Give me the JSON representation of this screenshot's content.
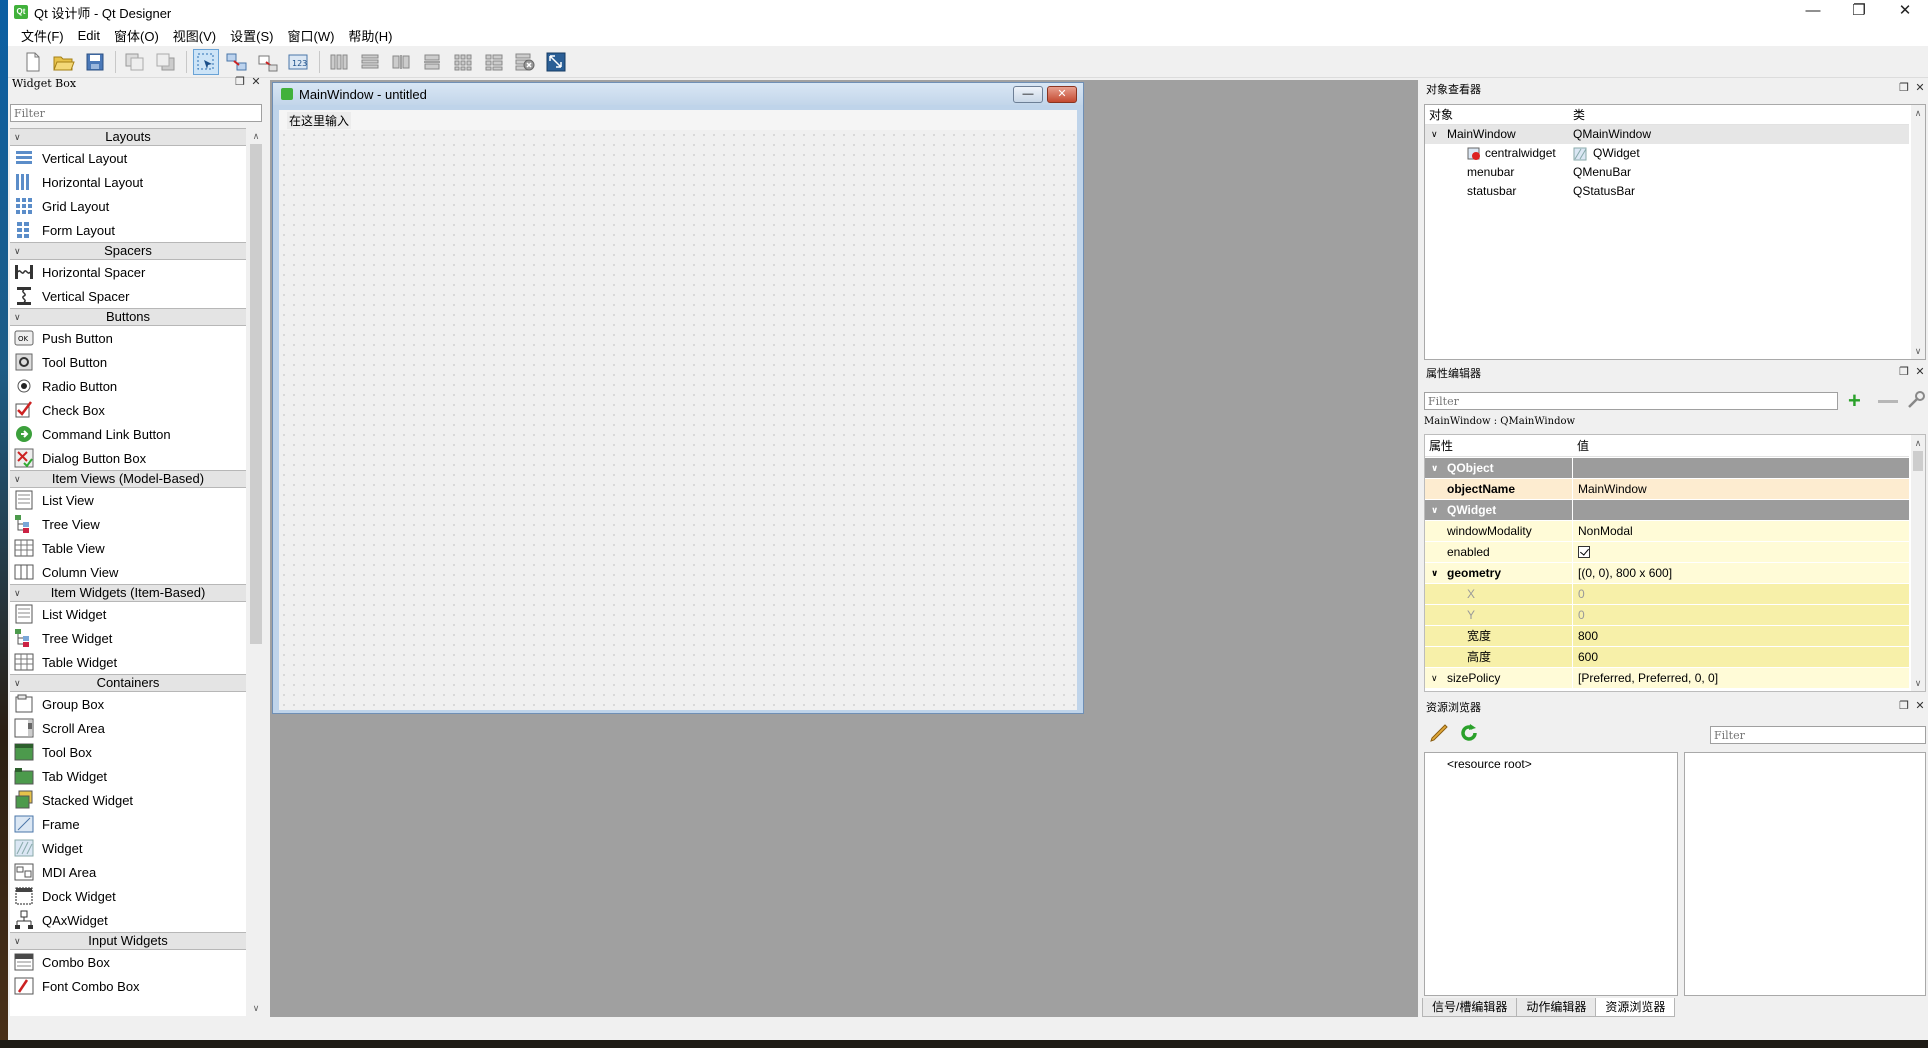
{
  "app": {
    "title": "Qt 设计师 - Qt Designer",
    "icon": "qt-icon"
  },
  "window_controls": {
    "minimize": "—",
    "restore": "❐",
    "close": "✕"
  },
  "menu": [
    "文件(F)",
    "Edit",
    "窗体(O)",
    "视图(V)",
    "设置(S)",
    "窗口(W)",
    "帮助(H)"
  ],
  "toolbar": {
    "icons": [
      "new-file-icon",
      "open-file-icon",
      "save-icon",
      "send-to-back-icon",
      "bring-to-front-icon",
      "edit-widgets-icon",
      "edit-signals-slots-icon",
      "edit-buddies-icon",
      "edit-tab-order-icon",
      "layout-horizontal-icon",
      "layout-vertical-icon",
      "layout-h-splitter-icon",
      "layout-v-splitter-icon",
      "layout-grid-icon",
      "layout-form-icon",
      "break-layout-icon",
      "adjust-size-icon"
    ]
  },
  "widget_box": {
    "title": "Widget Box",
    "filter_placeholder": "Filter",
    "categories": [
      {
        "name": "Layouts",
        "items": [
          "Vertical Layout",
          "Horizontal Layout",
          "Grid Layout",
          "Form Layout"
        ]
      },
      {
        "name": "Spacers",
        "items": [
          "Horizontal Spacer",
          "Vertical Spacer"
        ]
      },
      {
        "name": "Buttons",
        "items": [
          "Push Button",
          "Tool Button",
          "Radio Button",
          "Check Box",
          "Command Link Button",
          "Dialog Button Box"
        ]
      },
      {
        "name": "Item Views (Model-Based)",
        "items": [
          "List View",
          "Tree View",
          "Table View",
          "Column View"
        ]
      },
      {
        "name": "Item Widgets (Item-Based)",
        "items": [
          "List Widget",
          "Tree Widget",
          "Table Widget"
        ]
      },
      {
        "name": "Containers",
        "items": [
          "Group Box",
          "Scroll Area",
          "Tool Box",
          "Tab Widget",
          "Stacked Widget",
          "Frame",
          "Widget",
          "MDI Area",
          "Dock Widget",
          "QAxWidget"
        ]
      },
      {
        "name": "Input Widgets",
        "items": [
          "Combo Box",
          "Font Combo Box"
        ]
      }
    ]
  },
  "form": {
    "title": "MainWindow - untitled",
    "menu_placeholder": "在这里输入",
    "min": "—",
    "close": "✕"
  },
  "object_inspector": {
    "title": "对象查看器",
    "headers": [
      "对象",
      "类"
    ],
    "rows": [
      {
        "object": "MainWindow",
        "class": "QMainWindow"
      },
      {
        "object": "centralwidget",
        "class": "QWidget"
      },
      {
        "object": "menubar",
        "class": "QMenuBar"
      },
      {
        "object": "statusbar",
        "class": "QStatusBar"
      }
    ]
  },
  "property_editor": {
    "title": "属性编辑器",
    "filter_placeholder": "Filter",
    "context": "MainWindow : QMainWindow",
    "headers": [
      "属性",
      "值"
    ],
    "groups": {
      "qobject": "QObject",
      "qwidget": "QWidget"
    },
    "props": {
      "objectName": {
        "name": "objectName",
        "value": "MainWindow"
      },
      "windowModality": {
        "name": "windowModality",
        "value": "NonModal"
      },
      "enabled": {
        "name": "enabled",
        "value": true
      },
      "geometry": {
        "name": "geometry",
        "value": "[(0, 0), 800 x 600]"
      },
      "x": {
        "name": "X",
        "value": "0"
      },
      "y": {
        "name": "Y",
        "value": "0"
      },
      "width": {
        "name": "宽度",
        "value": "800"
      },
      "height": {
        "name": "高度",
        "value": "600"
      },
      "sizePolicy": {
        "name": "sizePolicy",
        "value": "[Preferred, Preferred, 0, 0]"
      }
    }
  },
  "resource_browser": {
    "title": "资源浏览器",
    "filter_placeholder": "Filter",
    "root": "<resource root>"
  },
  "bottom_tabs": [
    "信号/槽编辑器",
    "动作编辑器",
    "资源浏览器"
  ],
  "colors": {
    "accent": "#41b13b",
    "group_bg": "#9c9c9c",
    "selection": "#cde4f7"
  }
}
